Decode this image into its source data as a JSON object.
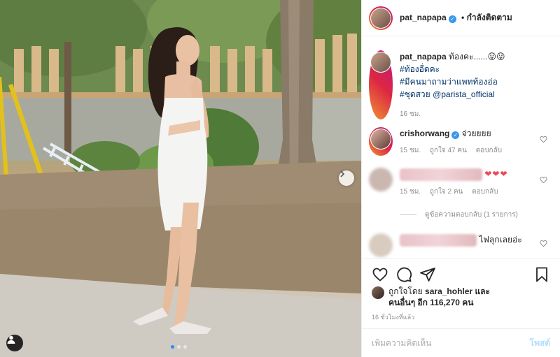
{
  "post_author": {
    "username": "pat_napapa",
    "follow_status": "• กำลังติดตาม"
  },
  "caption": {
    "username": "pat_napapa",
    "text": "ท้องคะ......😛😛",
    "hashtags": [
      "#ท้องอื่ดคะ",
      "#มีคนมาถามว่าแพทท้องอ่อ"
    ],
    "last_line_tag": "#ชุดสวย",
    "last_line_mention": "@parista_official",
    "time": "16 ชม."
  },
  "comments": [
    {
      "username": "crishorwang",
      "text": "จ่วยยยย",
      "time": "15 ชม.",
      "likes": "ถูกใจ 47 คน",
      "reply": "ตอบกลับ"
    },
    {
      "username": "",
      "text": "❤❤❤",
      "time": "15 ชม.",
      "likes": "ถูกใจ 2 คน",
      "reply": "ตอบกลับ",
      "view_replies": "ดูข้อความตอบกลับ (1 รายการ)"
    },
    {
      "username": "",
      "text": "ไฟลุกเลยอ่ะ"
    }
  ],
  "liked_by": {
    "prefix": "ถูกใจโดย",
    "user": "sara_hohler",
    "conjunction": "และ",
    "others": "คนอื่นๆ อีก 116,270 คน"
  },
  "posted_ago": "16 ชั่วโมงที่แล้ว",
  "comment_input": {
    "placeholder": "เพิ่มความคิดเห็น",
    "post_label": "โพสต์"
  },
  "icons": [
    "heart-icon",
    "comment-icon",
    "share-icon",
    "bookmark-icon",
    "chevron-right-icon",
    "person-tag-icon",
    "verified-badge-icon"
  ],
  "colors": {
    "link": "#003569",
    "verified": "#3897f0",
    "post_button": "#b2dffc",
    "heart": "#ed4956",
    "carousel_active": "#2d88ff"
  }
}
